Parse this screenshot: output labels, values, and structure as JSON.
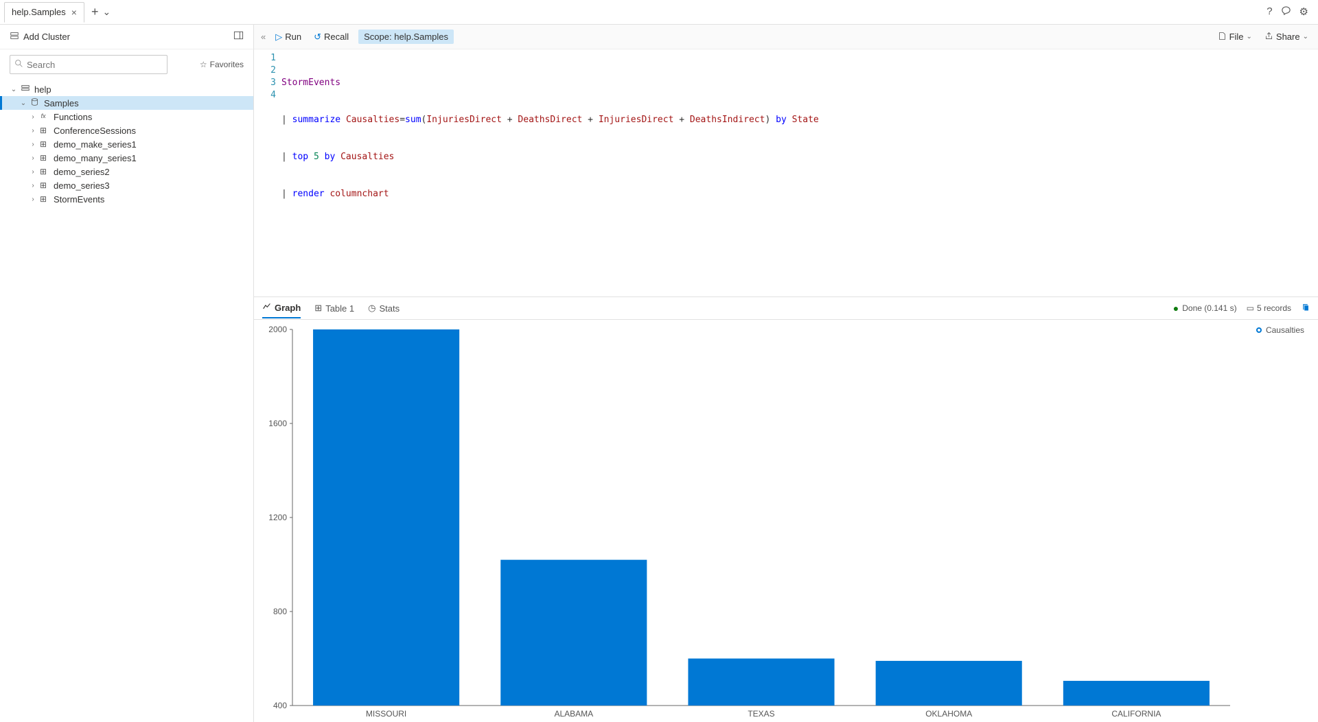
{
  "tab": {
    "title": "help.Samples"
  },
  "topicons": {
    "help": "?",
    "feedback": "⟟",
    "settings": "⚙"
  },
  "sidebar": {
    "add_cluster": "Add Cluster",
    "search_placeholder": "Search",
    "favorites": "Favorites",
    "tree": {
      "cluster": "help",
      "database": "Samples",
      "items": [
        {
          "type": "func",
          "label": "Functions"
        },
        {
          "type": "table",
          "label": "ConferenceSessions"
        },
        {
          "type": "table",
          "label": "demo_make_series1"
        },
        {
          "type": "table",
          "label": "demo_many_series1"
        },
        {
          "type": "table",
          "label": "demo_series2"
        },
        {
          "type": "table",
          "label": "demo_series3"
        },
        {
          "type": "table",
          "label": "StormEvents"
        }
      ]
    }
  },
  "toolbar": {
    "run": "Run",
    "recall": "Recall",
    "scope_label": "Scope:",
    "scope_value": "help.Samples",
    "file": "File",
    "share": "Share"
  },
  "editor": {
    "lines": [
      "1",
      "2",
      "3",
      "4"
    ],
    "code": {
      "l1": {
        "table": "StormEvents"
      },
      "l2": {
        "kw1": "summarize",
        "col": "Causalties",
        "eq": "=",
        "fn": "sum",
        "op": "(",
        "c1": "InjuriesDirect",
        "p1": " + ",
        "c2": "DeathsDirect",
        "p2": " + ",
        "c3": "InjuriesDirect",
        "p3": " + ",
        "c4": "DeathsIndirect",
        "cp": ")",
        "by": " by ",
        "c5": "State"
      },
      "l3": {
        "kw": "top",
        "n": "5",
        "by": "by",
        "col": "Causalties"
      },
      "l4": {
        "kw": "render",
        "arg": "columnchart"
      }
    }
  },
  "result_tabs": {
    "graph": "Graph",
    "table": "Table 1",
    "stats": "Stats"
  },
  "status": {
    "done": "Done (0.141 s)",
    "records": "5 records"
  },
  "legend": {
    "label": "Causalties"
  },
  "chart_data": {
    "type": "bar",
    "categories": [
      "MISSOURI",
      "ALABAMA",
      "TEXAS",
      "OKLAHOMA",
      "CALIFORNIA"
    ],
    "values": [
      2000,
      1020,
      600,
      590,
      505
    ],
    "title": "",
    "xlabel": "",
    "ylabel": "",
    "ylim": [
      400,
      2000
    ],
    "yticks": [
      400,
      800,
      1200,
      1600,
      2000
    ],
    "series_name": "Causalties"
  }
}
